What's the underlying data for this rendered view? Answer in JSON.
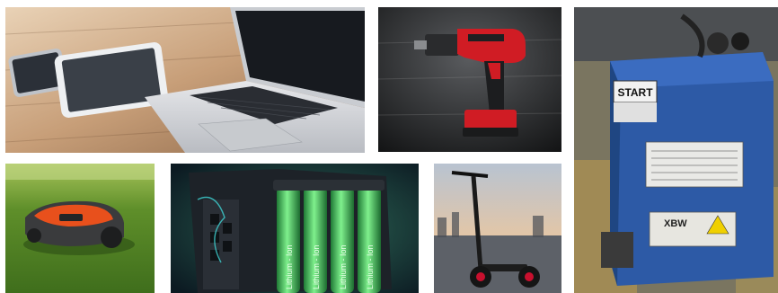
{
  "collage": {
    "images": [
      {
        "id": "laptop-tablet-phone",
        "subject": "laptop, tablet and smartphone on wooden desk"
      },
      {
        "id": "cordless-drill",
        "subject": "red cordless drill with battery pack on dark wood"
      },
      {
        "id": "forklift-battery",
        "subject": "blue industrial traction battery",
        "start_label": "START",
        "brand_label": "XBW"
      },
      {
        "id": "robotic-mower",
        "subject": "orange robotic lawn mower on grass"
      },
      {
        "id": "lithium-cells",
        "subject": "green glowing lithium-ion cells",
        "cell_labels": [
          "Lithium - Ion",
          "Lithium - Ion",
          "Lithium - Ion",
          "Lithium - Ion"
        ]
      },
      {
        "id": "electric-scooter",
        "subject": "electric kick scooter on road at sunset"
      }
    ]
  },
  "colors": {
    "wood_light": "#b58a63",
    "drill_red": "#d01c24",
    "battery_blue": "#2d5aa6",
    "grass_green": "#5f8f2a",
    "cell_green": "#54d36a",
    "sky_dusk": "#9aa7b7"
  }
}
